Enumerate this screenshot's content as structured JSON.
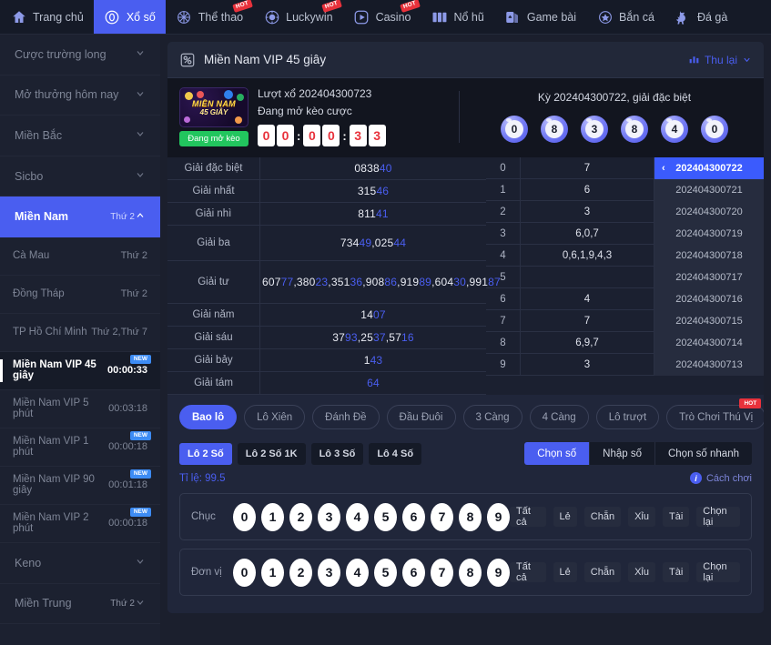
{
  "topnav": {
    "items": [
      {
        "label": "Trang chủ",
        "icon": "home-icon",
        "active": false,
        "hot": false
      },
      {
        "label": "Xổ số",
        "icon": "lottery-coin-icon",
        "active": true,
        "hot": false
      },
      {
        "label": "Thể thao",
        "icon": "sports-ball-icon",
        "active": false,
        "hot": true
      },
      {
        "label": "Luckywin",
        "icon": "poker-chip-icon",
        "active": false,
        "hot": true
      },
      {
        "label": "Casino",
        "icon": "play-circle-icon",
        "active": false,
        "hot": true
      },
      {
        "label": "Nổ hũ",
        "icon": "slot-machine-icon",
        "active": false,
        "hot": false
      },
      {
        "label": "Game bài",
        "icon": "playing-cards-icon",
        "active": false,
        "hot": false
      },
      {
        "label": "Bắn cá",
        "icon": "fish-star-icon",
        "active": false,
        "hot": false
      },
      {
        "label": "Đá gà",
        "icon": "rooster-icon",
        "active": false,
        "hot": false
      }
    ],
    "hot_label": "HOT"
  },
  "sidebar": {
    "groups": [
      {
        "label": "Cược trường long",
        "chevron": "down",
        "active": false
      },
      {
        "label": "Mở thưởng hôm nay",
        "chevron": "down",
        "active": false
      },
      {
        "label": "Miền Bắc",
        "chevron": "down",
        "active": false
      },
      {
        "label": "Sicbo",
        "chevron": "down",
        "active": false
      },
      {
        "label": "Miền Nam",
        "tag": "Thứ 2",
        "chevron": "up",
        "active": true
      }
    ],
    "children": [
      {
        "name": "Cà Mau",
        "day": "Thứ 2",
        "selected": false,
        "new": false
      },
      {
        "name": "Đồng Tháp",
        "day": "Thứ 2",
        "selected": false,
        "new": false
      },
      {
        "name": "TP Hồ Chí Minh",
        "day": "Thứ 2,Thứ 7",
        "selected": false,
        "new": false
      },
      {
        "name": "Miền Nam VIP 45 giây",
        "day": "00:00:33",
        "selected": true,
        "new": true
      },
      {
        "name": "Miền Nam VIP 5 phút",
        "day": "00:03:18",
        "selected": false,
        "new": false
      },
      {
        "name": "Miền Nam VIP 1 phút",
        "day": "00:00:18",
        "selected": false,
        "new": true
      },
      {
        "name": "Miền Nam VIP 90 giây",
        "day": "00:01:18",
        "selected": false,
        "new": true
      },
      {
        "name": "Miền Nam VIP 2 phút",
        "day": "00:00:18",
        "selected": false,
        "new": true
      }
    ],
    "groups_after": [
      {
        "label": "Keno",
        "chevron": "down",
        "active": false
      },
      {
        "label": "Miền Trung",
        "tag": "Thứ 2",
        "chevron": "down",
        "active": false
      }
    ],
    "new_badge": "NEW"
  },
  "panel": {
    "title": "Miền Nam VIP 45 giây",
    "collapse_label": "Thu lại"
  },
  "draw": {
    "logo_line1": "MIỀN NAM",
    "logo_line2": "45 GIÂY",
    "status_tag": "Đang mở kèo",
    "round_label": "Lượt xổ 202404300723",
    "round_status": "Đang mở kèo cược",
    "timer_digits": [
      "0",
      "0",
      "0",
      "0",
      "3",
      "3"
    ],
    "timer_separator": ":",
    "prev_label": "Kỳ 202404300722, giải đặc biệt",
    "prev_balls": [
      "0",
      "8",
      "3",
      "8",
      "4",
      "0"
    ]
  },
  "results": {
    "rows": [
      {
        "label": "Giải đặc biệt",
        "value": "083840",
        "head": "0838",
        "tail": "40"
      },
      {
        "label": "Giải nhất",
        "value": "31546",
        "head": "315",
        "tail": "46"
      },
      {
        "label": "Giải nhì",
        "value": "81141",
        "head": "811",
        "tail": "41"
      },
      {
        "label": "Giải ba",
        "value": "73449,02544",
        "numbers": [
          "73449",
          "02544"
        ]
      },
      {
        "label": "Giải tư",
        "value": "60777,38023,35136,90886,91989,60430,99187",
        "numbers": [
          "60777",
          "38023",
          "35136",
          "90886",
          "91989",
          "60430",
          "99187"
        ]
      },
      {
        "label": "Giải năm",
        "value": "1407",
        "head": "14",
        "tail": "07"
      },
      {
        "label": "Giải sáu",
        "value": "3793,2537,5716",
        "numbers": [
          "3793",
          "2537",
          "5716"
        ]
      },
      {
        "label": "Giải bảy",
        "value": "143",
        "head": "1",
        "tail": "43"
      },
      {
        "label": "Giải tám",
        "value": "64",
        "head": "",
        "tail": "64"
      }
    ],
    "digit_rows": [
      {
        "index": "0",
        "digits": "7",
        "period": "202404300722",
        "current": true
      },
      {
        "index": "1",
        "digits": "6",
        "period": "202404300721",
        "current": false
      },
      {
        "index": "2",
        "digits": "3",
        "period": "202404300720",
        "current": false
      },
      {
        "index": "3",
        "digits": "6,0,7",
        "period": "202404300719",
        "current": false
      },
      {
        "index": "4",
        "digits": "0,6,1,9,4,3",
        "period": "202404300718",
        "current": false
      },
      {
        "index": "5",
        "digits": "",
        "period": "202404300717",
        "current": false
      },
      {
        "index": "6",
        "digits": "4",
        "period": "202404300716",
        "current": false
      },
      {
        "index": "7",
        "digits": "7",
        "period": "202404300715",
        "current": false
      },
      {
        "index": "8",
        "digits": "6,9,7",
        "period": "202404300714",
        "current": false
      },
      {
        "index": "9",
        "digits": "3",
        "period": "202404300713",
        "current": false
      }
    ],
    "back_arrow": "‹"
  },
  "tabs": [
    {
      "label": "Bao lô",
      "active": true,
      "hot": false
    },
    {
      "label": "Lô Xiên",
      "active": false,
      "hot": false
    },
    {
      "label": "Đánh Đề",
      "active": false,
      "hot": false
    },
    {
      "label": "Đầu Đuôi",
      "active": false,
      "hot": false
    },
    {
      "label": "3 Càng",
      "active": false,
      "hot": false
    },
    {
      "label": "4 Càng",
      "active": false,
      "hot": false
    },
    {
      "label": "Lô trượt",
      "active": false,
      "hot": false
    },
    {
      "label": "Trò Chơi Thú Vị",
      "active": false,
      "hot": true
    }
  ],
  "tabs_hot_label": "HOT",
  "subtabs": [
    {
      "label": "Lô 2 Số",
      "active": true
    },
    {
      "label": "Lô 2 Số 1K",
      "active": false
    },
    {
      "label": "Lô 3 Số",
      "active": false
    },
    {
      "label": "Lô 4 Số",
      "active": false
    }
  ],
  "modes": [
    {
      "label": "Chọn số",
      "active": true
    },
    {
      "label": "Nhập số",
      "active": false
    },
    {
      "label": "Chọn số nhanh",
      "active": false
    }
  ],
  "ratio": {
    "label": "Tỉ lệ:",
    "value": "99.5",
    "howto": "Cách chơi",
    "info_glyph": "i"
  },
  "picker": {
    "rows": [
      {
        "label": "Chục",
        "digits": [
          "0",
          "1",
          "2",
          "3",
          "4",
          "5",
          "6",
          "7",
          "8",
          "9"
        ],
        "quick": [
          "Tất cả",
          "Lẻ",
          "Chẵn",
          "Xỉu",
          "Tài",
          "Chọn lại"
        ]
      },
      {
        "label": "Đơn vị",
        "digits": [
          "0",
          "1",
          "2",
          "3",
          "4",
          "5",
          "6",
          "7",
          "8",
          "9"
        ],
        "quick": [
          "Tất cả",
          "Lẻ",
          "Chẵn",
          "Xỉu",
          "Tài",
          "Chọn lại"
        ]
      }
    ]
  },
  "colors": {
    "accent": "#4a5ef0",
    "hot": "#e8323c",
    "new": "#3d8cf5",
    "live": "#22c55e",
    "timer_digit": "#e8323c"
  }
}
